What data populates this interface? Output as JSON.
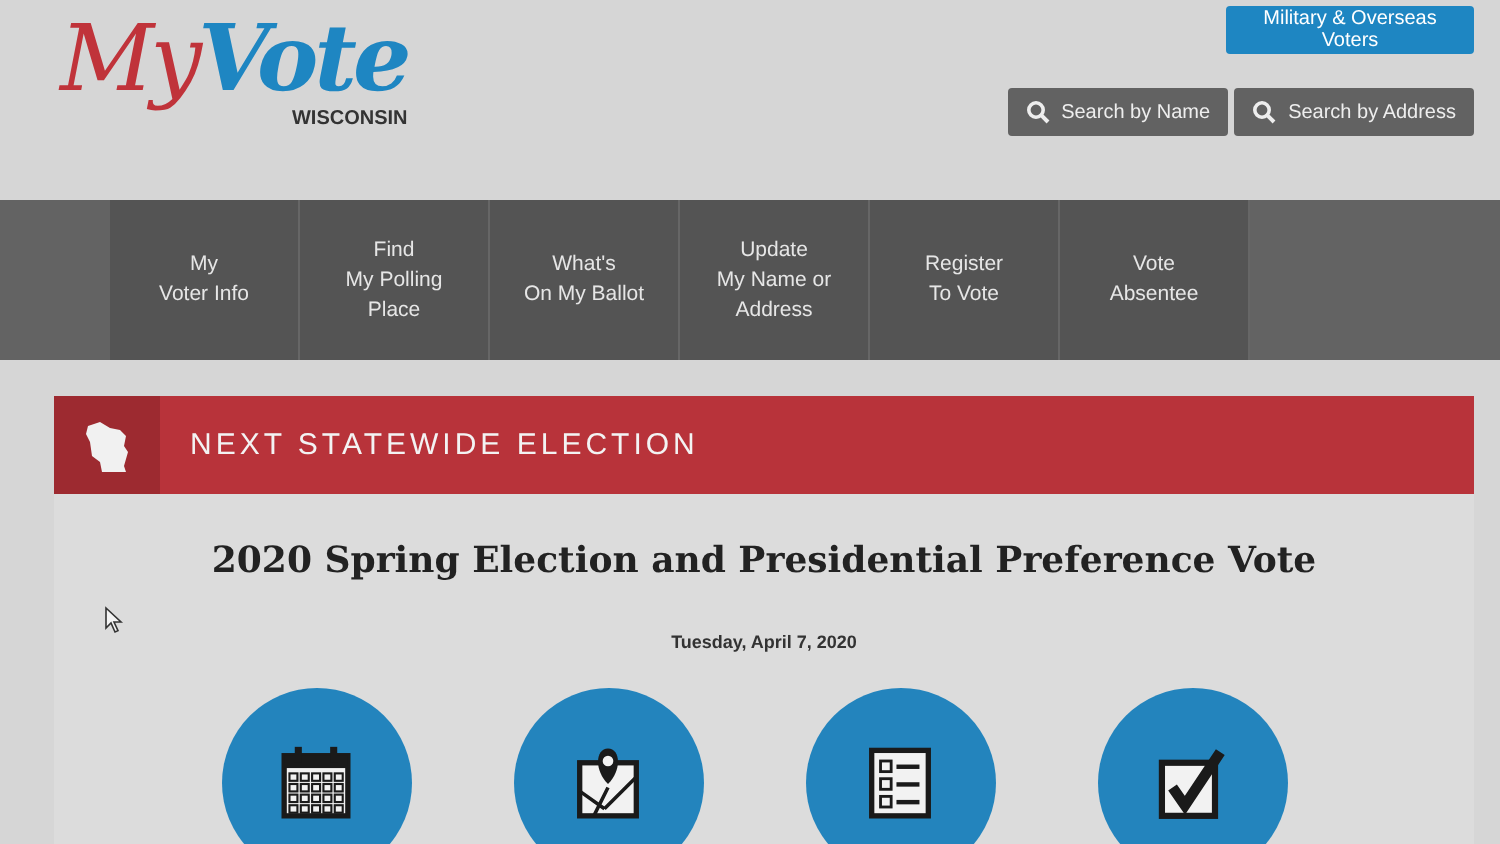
{
  "logo": {
    "first": "My",
    "second": "Vote",
    "subtitle": "WISCONSIN"
  },
  "top_button": "Military & Overseas Voters",
  "search_buttons": [
    "Search by Name",
    "Search by Address"
  ],
  "nav": [
    {
      "lines": [
        "My",
        "Voter Info"
      ]
    },
    {
      "lines": [
        "Find",
        "My Polling",
        "Place"
      ]
    },
    {
      "lines": [
        "What's",
        "On My Ballot"
      ]
    },
    {
      "lines": [
        "Update",
        "My Name or",
        "Address"
      ]
    },
    {
      "lines": [
        "Register",
        "To Vote"
      ]
    },
    {
      "lines": [
        "Vote",
        "Absentee"
      ]
    }
  ],
  "election": {
    "banner": "NEXT STATEWIDE ELECTION",
    "title": "2020 Spring Election and Presidential Preference Vote",
    "date": "Tuesday, April 7, 2020"
  },
  "features": [
    {
      "kind": "calendar"
    },
    {
      "kind": "map"
    },
    {
      "kind": "checklist"
    },
    {
      "kind": "checkbox"
    }
  ]
}
